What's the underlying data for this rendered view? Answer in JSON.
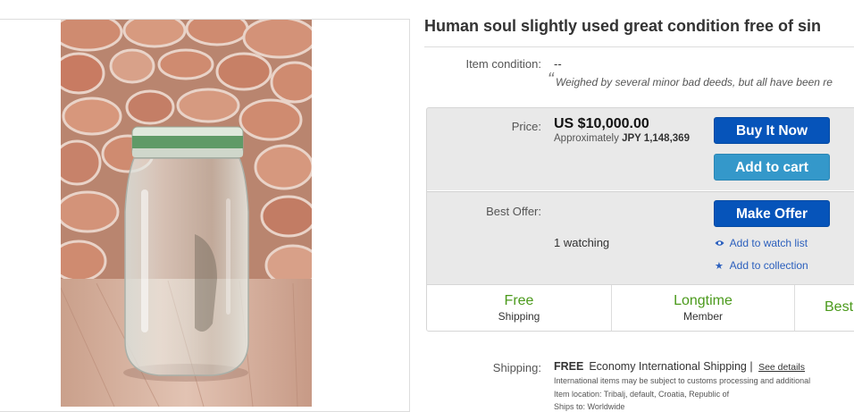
{
  "listing": {
    "title": "Human soul slightly used great condition free of sin"
  },
  "condition": {
    "label": "Item condition:",
    "value": "--",
    "quote_mark": "“",
    "description": "Weighed by several minor bad deeds, but all have been re"
  },
  "buy_box": {
    "price_label": "Price:",
    "price": "US $10,000.00",
    "approx_prefix": "Approximately",
    "approx_value": "JPY 1,148,369",
    "buy_now_label": "Buy It Now",
    "add_to_cart_label": "Add to cart",
    "best_offer_label": "Best Offer:",
    "make_offer_label": "Make Offer",
    "watching": "1 watching",
    "watch_link": "Add to watch list",
    "collection_link": "Add to collection"
  },
  "features": [
    {
      "title": "Free",
      "subtitle": "Shipping"
    },
    {
      "title": "Longtime",
      "subtitle": "Member"
    },
    {
      "title": "Best",
      "subtitle": ""
    }
  ],
  "shipping": {
    "label": "Shipping:",
    "free": "FREE",
    "method": "Economy International Shipping |",
    "see_details": "See details",
    "note": "International items may be subject to customs processing and additional",
    "location": "Item location:  Tribalj, default, Croatia, Republic of",
    "cut_line": "Ships to:  Worldwide"
  },
  "colors": {
    "accent_blue": "#0654ba",
    "cart_blue": "#3498ca",
    "feature_green": "#4b9a1c",
    "link_blue": "#2b5fbd"
  },
  "icons": {
    "watch": "eye-icon",
    "collection": "star-icon"
  }
}
